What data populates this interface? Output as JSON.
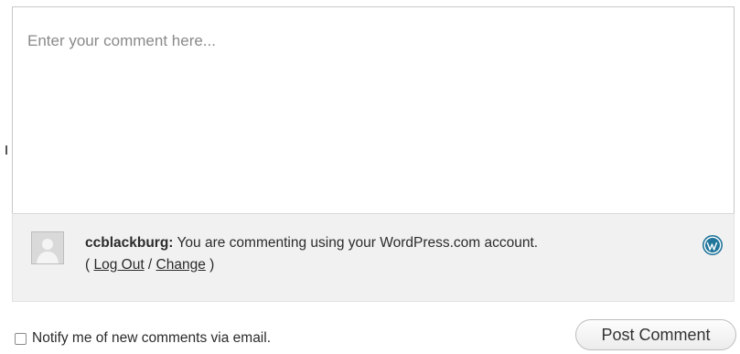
{
  "comment": {
    "placeholder": "Enter your comment here..."
  },
  "identity": {
    "username": "ccblackburg:",
    "message": " You are commenting using your WordPress.com account.",
    "open_paren": "( ",
    "logout_label": "Log Out",
    "separator": " / ",
    "change_label": "Change",
    "close_paren": " )",
    "avatar_icon": "default-avatar-icon",
    "service_icon": "wordpress-logo-icon",
    "service_color": "#21759b"
  },
  "footer": {
    "notify_label": "Notify me of new comments via email.",
    "notify_checked": false,
    "post_button_label": "Post Comment"
  }
}
